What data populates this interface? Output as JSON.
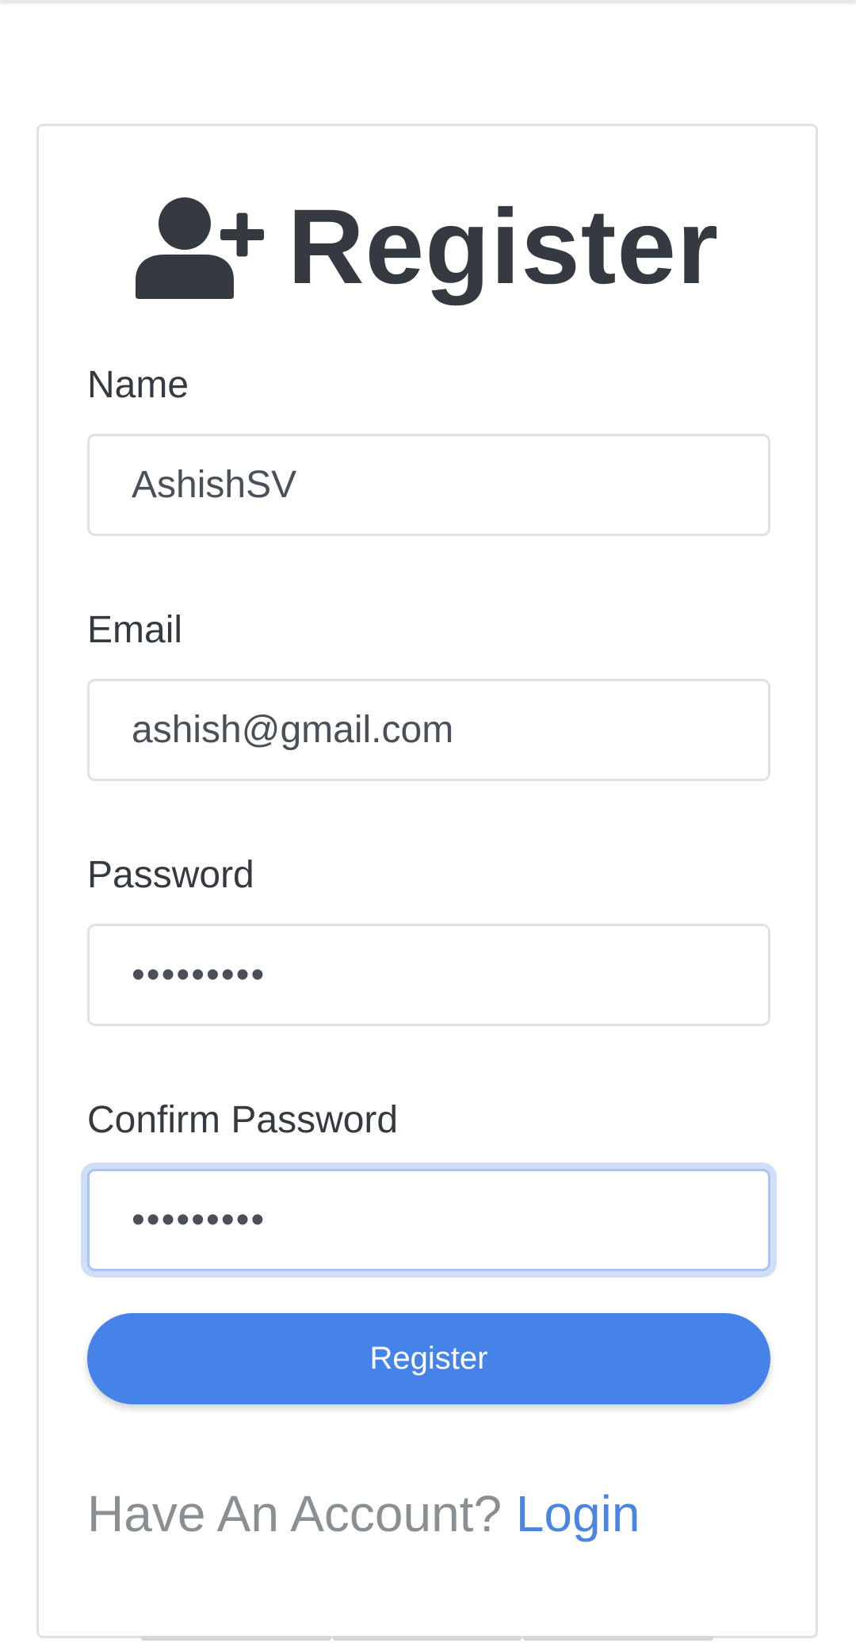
{
  "header": {
    "title": "Register",
    "title_icon": "user-plus-icon"
  },
  "form": {
    "name_label": "Name",
    "name_value": "AshishSV",
    "email_label": "Email",
    "email_value": "ashish@gmail.com",
    "password_label": "Password",
    "password_value": "•••••••••",
    "confirm_label": "Confirm Password",
    "confirm_value": "•••••••••",
    "submit_label": "Register"
  },
  "footer": {
    "prompt": "Have An Account?",
    "login_label": "Login"
  },
  "colors": {
    "primary": "#4683e9",
    "link": "#4a86df",
    "text_dark": "#343a40",
    "muted": "#8a8f94",
    "border": "#dfe1e4",
    "focus_ring": "#a8c4f2"
  }
}
